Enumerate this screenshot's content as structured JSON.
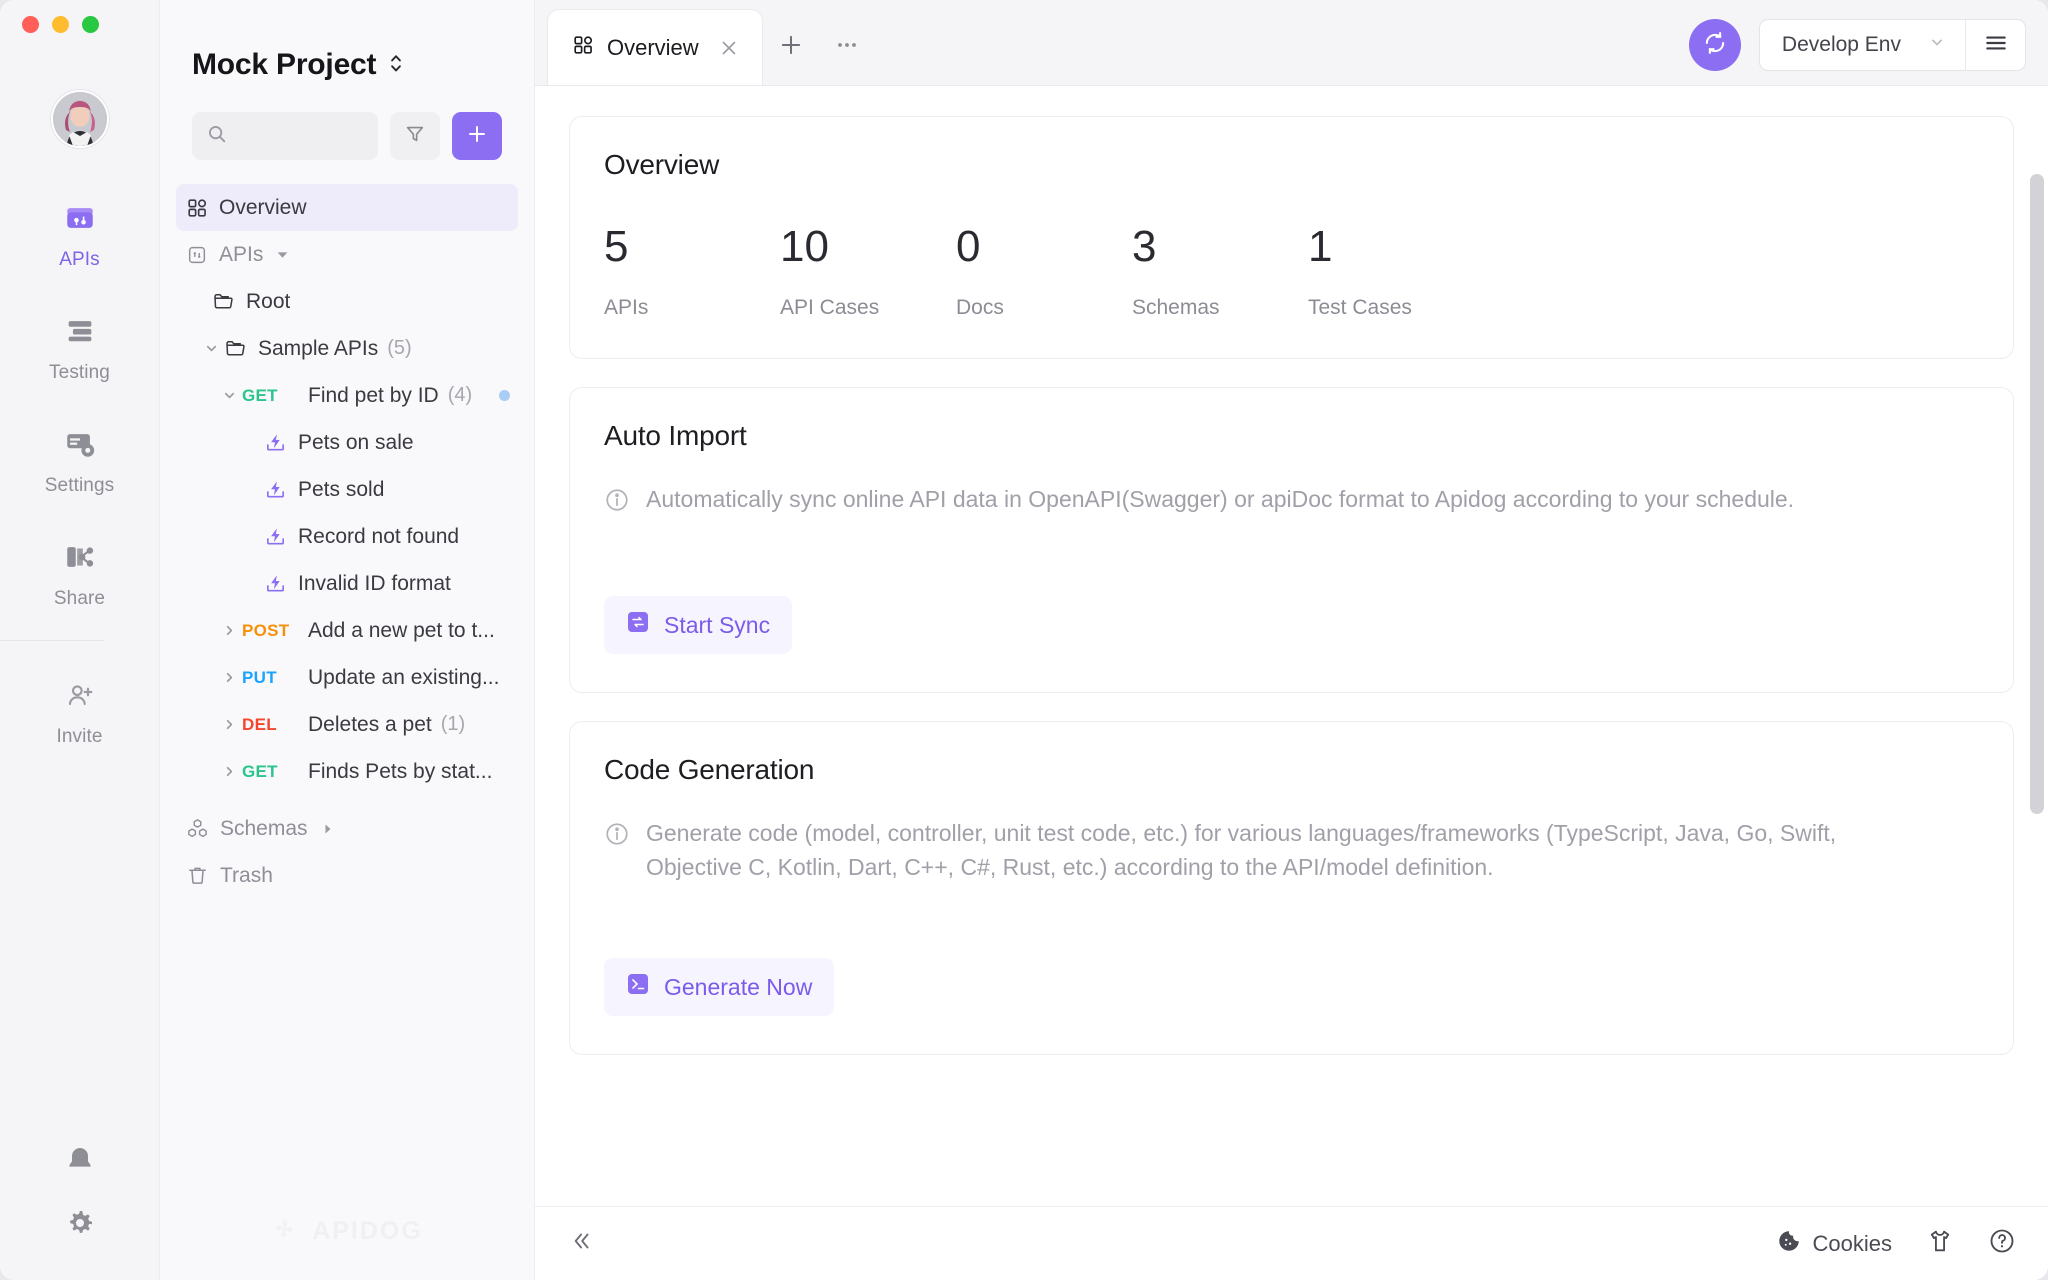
{
  "window": {
    "traffic": [
      "close",
      "minimize",
      "zoom"
    ]
  },
  "rail": {
    "avatar_alt": "user-avatar",
    "items": [
      {
        "label": "APIs",
        "icon": "apis-icon",
        "active": true
      },
      {
        "label": "Testing",
        "icon": "testing-icon",
        "active": false
      },
      {
        "label": "Settings",
        "icon": "settings-icon",
        "active": false
      },
      {
        "label": "Share",
        "icon": "share-icon",
        "active": false
      }
    ],
    "invite": {
      "label": "Invite",
      "icon": "invite-icon"
    },
    "bottom": [
      {
        "icon": "bell-icon",
        "label": "Notifications"
      },
      {
        "icon": "gear-icon",
        "label": "Preferences"
      }
    ]
  },
  "sidebar": {
    "project_title": "Mock Project",
    "project_switch_icon": "chevron-up-down-icon",
    "search": {
      "placeholder": "",
      "value": "",
      "icon": "search-icon"
    },
    "filter_icon": "filter-icon",
    "add_icon": "plus-icon",
    "overview_item": {
      "label": "Overview",
      "icon": "grid-icon"
    },
    "apis_group": {
      "label": "APIs",
      "icon": "apis-small-icon",
      "caret": "caret-down-icon"
    },
    "tree": [
      {
        "label": "Root",
        "icon": "folder-icon",
        "indent": 1,
        "caret": "",
        "count": ""
      },
      {
        "label": "Sample APIs",
        "icon": "folder-icon",
        "indent": 1,
        "caret": "chevron-down-icon",
        "count": "(5)"
      },
      {
        "label": "Find pet by ID",
        "method": "GET",
        "indent": 2,
        "caret": "chevron-down-icon",
        "count": "(4)",
        "dot": true
      },
      {
        "label": "Pets on sale",
        "icon": "case-icon",
        "indent": 3,
        "caret": "",
        "count": ""
      },
      {
        "label": "Pets sold",
        "icon": "case-icon",
        "indent": 3,
        "caret": "",
        "count": ""
      },
      {
        "label": "Record not found",
        "icon": "case-icon",
        "indent": 3,
        "caret": "",
        "count": ""
      },
      {
        "label": "Invalid ID format",
        "icon": "case-icon",
        "indent": 3,
        "caret": "",
        "count": ""
      },
      {
        "label": "Add a new pet to t...",
        "method": "POST",
        "indent": 2,
        "caret": "chevron-right-icon",
        "count": ""
      },
      {
        "label": "Update an existing...",
        "method": "PUT",
        "indent": 2,
        "caret": "chevron-right-icon",
        "count": ""
      },
      {
        "label": "Deletes a pet",
        "method": "DEL",
        "indent": 2,
        "caret": "chevron-right-icon",
        "count": "(1)"
      },
      {
        "label": "Finds Pets by stat...",
        "method": "GET",
        "indent": 2,
        "caret": "chevron-right-icon",
        "count": ""
      }
    ],
    "schemas_item": {
      "label": "Schemas",
      "icon": "cubes-icon",
      "caret": "caret-right-icon"
    },
    "trash_item": {
      "label": "Trash",
      "icon": "trash-icon"
    },
    "watermark": "APIDOG"
  },
  "tabbar": {
    "tabs": [
      {
        "label": "Overview",
        "icon": "grid-icon",
        "close_icon": "close-icon",
        "active": true
      }
    ],
    "new_tab_icon": "plus-icon",
    "more_icon": "ellipsis-icon",
    "sync_icon": "sync-icon",
    "environment": {
      "value": "Develop Env",
      "caret": "chevron-down-icon"
    },
    "menu_icon": "hamburger-icon"
  },
  "main": {
    "overview": {
      "title": "Overview",
      "stats": [
        {
          "value": "5",
          "label": "APIs"
        },
        {
          "value": "10",
          "label": "API Cases"
        },
        {
          "value": "0",
          "label": "Docs"
        },
        {
          "value": "3",
          "label": "Schemas"
        },
        {
          "value": "1",
          "label": "Test Cases"
        }
      ]
    },
    "auto_import": {
      "title": "Auto Import",
      "info_icon": "info-icon",
      "description": "Automatically sync online API data in OpenAPI(Swagger) or apiDoc format to Apidog according to your schedule.",
      "button": {
        "label": "Start Sync",
        "icon": "sync-small-icon"
      }
    },
    "code_generation": {
      "title": "Code Generation",
      "info_icon": "info-icon",
      "description": "Generate code (model, controller, unit test code, etc.) for various languages/frameworks (TypeScript, Java, Go, Swift, Objective C, Kotlin, Dart, C++, C#, Rust, etc.) according to the API/model definition.",
      "button": {
        "label": "Generate Now",
        "icon": "terminal-icon"
      }
    }
  },
  "statusbar": {
    "collapse_icon": "double-chevron-left-icon",
    "cookies": {
      "label": "Cookies",
      "icon": "cookie-icon"
    },
    "tshirt_icon": "tshirt-icon",
    "help_icon": "help-circle-icon"
  },
  "colors": {
    "accent": "#8c6ef2",
    "accent_soft": "#eeebfb",
    "get": "#2bc48a",
    "post": "#f79009",
    "put": "#1aa3ff",
    "del": "#f5462d",
    "dot": "#a9cdf5",
    "text": "#2a2a31",
    "muted": "#8c8c95"
  }
}
